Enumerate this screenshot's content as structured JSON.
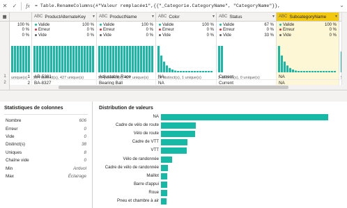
{
  "formula_bar": {
    "cancel_icon": "x-icon",
    "commit_icon": "check-icon",
    "fx_label": "fx",
    "expression": "= Table.RenameColumns(#\"Valeur remplacée1\",{{\"_Categorie.CategoryName\", \"CategoryName\"}},"
  },
  "columns": [
    {
      "name": "",
      "type": "",
      "valide": "100 %",
      "erreur": "0 %",
      "vide": "0 %",
      "dist": "unique(s)",
      "bars": "uniform",
      "cells": [
        "1",
        "2"
      ],
      "num": true
    },
    {
      "name": "ProductAlternateKey",
      "type": "ABC",
      "valide": "100 %",
      "erreur": "0 %",
      "vide": "0 %",
      "dist": "504 distinct(s), 427 unique(s)",
      "bars": "uniform",
      "cells": [
        "AR-5381",
        "BA-8327"
      ]
    },
    {
      "name": "ProductName",
      "type": "ABC",
      "valide": "100 %",
      "erreur": "0 %",
      "vide": "0 %",
      "dist": "504 distinct(s), 427 unique(s)",
      "bars": "uniform",
      "cells": [
        "Adjustable Race",
        "Bearing Ball"
      ]
    },
    {
      "name": "Color",
      "type": "ABC",
      "valide": "100 %",
      "erreur": "0 %",
      "vide": "0 %",
      "dist": "10 distinct(s), 1 unique(s)",
      "bars": "skewed",
      "cells": [
        "NA",
        "NA"
      ]
    },
    {
      "name": "Status",
      "type": "ABC",
      "valide": "67 %",
      "erreur": "0 %",
      "vide": "33 %",
      "dist": "2 distinct(s), 0 unique(s)",
      "bars": "two",
      "cells": [
        "Current",
        "Current"
      ]
    },
    {
      "name": "SubcategoryName",
      "type": "ABC",
      "valide": "100 %",
      "erreur": "0 %",
      "vide": "0 %",
      "dist": "38 distinct(s), 8 unique(s)",
      "bars": "skewed",
      "cells": [
        "NA",
        "NA"
      ],
      "selected": true
    },
    {
      "name": "",
      "type": "ABC",
      "valide": "",
      "erreur": "",
      "vide": "",
      "dist": "5 -",
      "bars": "tail",
      "cells": [
        "",
        ""
      ]
    }
  ],
  "row_numbers": [
    "1",
    "2"
  ],
  "quality_labels": {
    "valide": "Valide",
    "erreur": "Erreur",
    "vide": "Vide"
  },
  "colors": {
    "valide": "#15b9a6",
    "erreur": "#d13438",
    "vide": "#605e5c",
    "accent": "#f2c811",
    "bar": "#15b9a6"
  },
  "stats": {
    "title": "Statistiques de colonnes",
    "rows": [
      {
        "label": "Nombre",
        "value": "606"
      },
      {
        "label": "Erreur",
        "value": "0"
      },
      {
        "label": "Vide",
        "value": "0"
      },
      {
        "label": "Distinct(s)",
        "value": "38"
      },
      {
        "label": "Uniques",
        "value": "8"
      },
      {
        "label": "Chaîne vide",
        "value": "0"
      },
      {
        "label": "Min",
        "value": "Antivol"
      },
      {
        "label": "Max",
        "value": "Éclairage"
      }
    ]
  },
  "chart_data": {
    "type": "bar",
    "title": "Distribution de valeurs",
    "orientation": "horizontal",
    "categories": [
      "NA",
      "Cadre de vélo de route",
      "Vélo de route",
      "Cadre de VTT",
      "VTT",
      "Vélo de randonnée",
      "Cadre de vélo de randonnée",
      "Maillot",
      "Barre d'appui",
      "Roue",
      "Pneu et chambre à air"
    ],
    "values": [
      210,
      44,
      43,
      33,
      32,
      14,
      9,
      8,
      8,
      8,
      7
    ],
    "xlim": [
      0,
      210
    ]
  }
}
